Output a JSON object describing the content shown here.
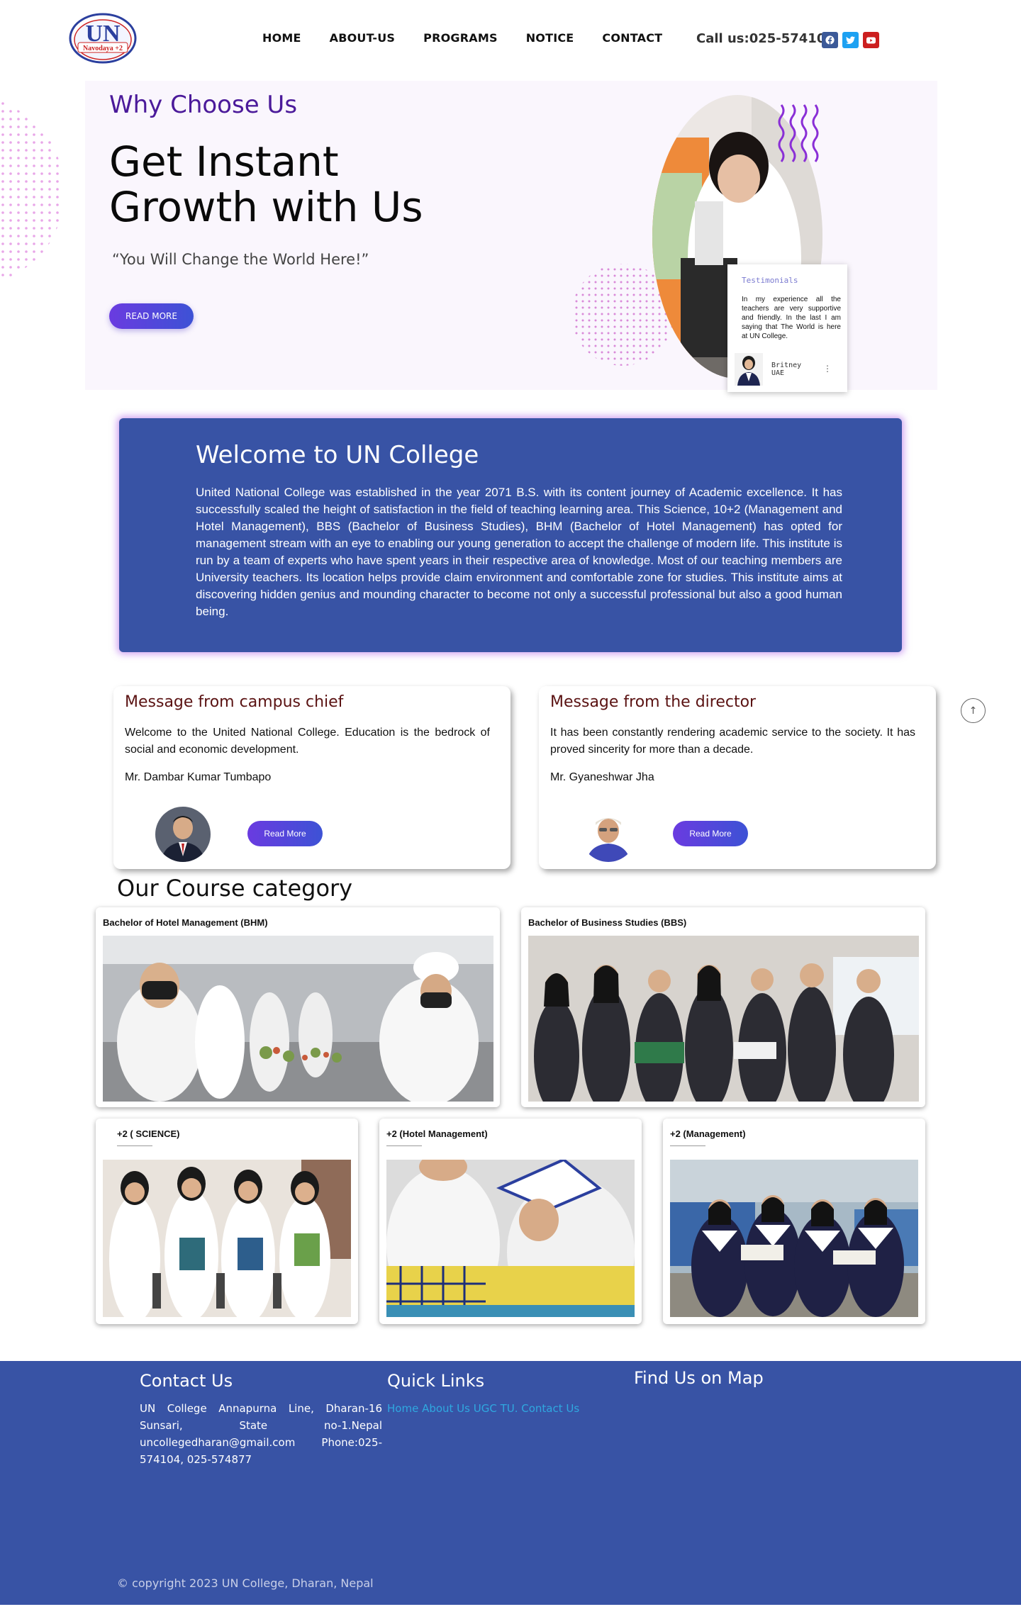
{
  "header": {
    "logo_text": "Navodaya +2",
    "nav": [
      "HOME",
      "ABOUT-US",
      "PROGRAMS",
      "NOTICE",
      "CONTACT"
    ],
    "call_us": "Call us:025-574104",
    "social_icons": [
      "facebook-icon",
      "twitter-icon",
      "youtube-icon"
    ]
  },
  "hero": {
    "kicker": "Why Choose Us",
    "title": "Get Instant Growth with Us",
    "quote": "“You Will Change the World Here!”",
    "button": "READ MORE",
    "testimonial": {
      "title": "Testimonials",
      "text": "In my experience all the teachers are very supportive and friendly. In the last I am saying that The World is here at UN College.",
      "name": "Britney",
      "location": "UAE"
    }
  },
  "welcome": {
    "title": "Welcome to UN College",
    "body": "United National College was established in the year 2071 B.S. with its content journey of Academic excellence. It has successfully scaled the height of satisfaction in the field of teaching learning area. This  Science, 10+2 (Management and Hotel Management), BBS (Bachelor of Business Studies), BHM (Bachelor of Hotel Management) has opted for management stream with an eye to enabling our young generation to accept the challenge of modern life. This institute is run by a team of experts who have spent years in their respective area of knowledge. Most of our teaching members are University teachers. Its location helps provide claim environment and comfortable zone for studies. This institute aims at discovering hidden genius and mounding character to become not only a successful professional but also a good human being."
  },
  "messages": [
    {
      "title": "Message from campus chief",
      "text": "Welcome to the United National College. Education is the bedrock of social and economic development.",
      "author": "Mr. Dambar Kumar Tumbapo",
      "button": "Read More"
    },
    {
      "title": "Message from the director",
      "text": "It has been constantly rendering academic service to the society. It has proved sincerity for more than a decade.",
      "author": "Mr. Gyaneshwar Jha",
      "button": "Read More"
    }
  ],
  "courses": {
    "title": "Our Course category",
    "items": [
      "Bachelor of Hotel Management (BHM)",
      "Bachelor of Business Studies (BBS)",
      "+2 ( SCIENCE)",
      "+2 (Hotel Management)",
      "+2 (Management)"
    ]
  },
  "footer": {
    "contact_title": "Contact Us",
    "contact_text": "UN College Annapurna Line, Dharan-16 Sunsari, State no-1.Nepal uncollegedharan@gmail.com Phone:025-574104, 025-574877",
    "links_title": "Quick Links",
    "links_text": "Home About Us UGC TU. Contact Us",
    "map_title": "Find Us on Map",
    "copyright": "© copyright 2023 UN College, Dharan, Nepal"
  },
  "colors": {
    "brand_blue": "#3853a5",
    "purple": "#4b1a9a",
    "button_gradient_start": "#6a3be0",
    "button_gradient_end": "#3d52d5",
    "facebook": "#3b5998",
    "twitter": "#1da1f2",
    "youtube": "#cc1f1f"
  }
}
